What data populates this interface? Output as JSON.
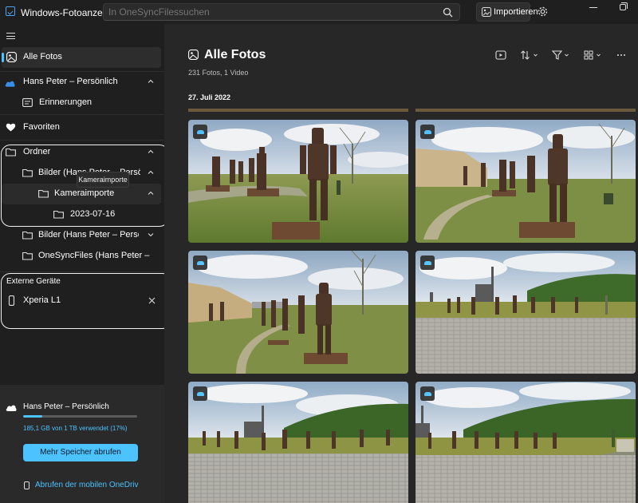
{
  "titlebar": {
    "app_title": "Windows-Fotoanzeige",
    "search_placeholder": "In OneSyncFilessuchen",
    "import_label": "Importieren"
  },
  "sidebar": {
    "all_photos": "Alle Fotos",
    "account": "Hans Peter – Persönlich",
    "memories": "Erinnerungen",
    "favorites": "Favoriten",
    "folders": "Ordner",
    "folder_pictures_1": "Bilder (Hans Peter – Persönlich)",
    "folder_camera_imports": "Kameraimporte",
    "folder_date": "2023-07-16",
    "folder_pictures_2": "Bilder (Hans Peter – Persönlich)",
    "folder_onesync": "OneSyncFiles (Hans Peter – Persönlich)",
    "tooltip": "Kameraimporte",
    "external_devices": "Externe Geräte",
    "device": "Xperia L1",
    "storage": {
      "title": "Hans Peter – Persönlich",
      "used_text": "185,1 GB von 1 TB verwendet (17%)",
      "used_fraction": 0.17,
      "more_storage": "Mehr Speicher abrufen",
      "mobile_link": "Abrufen der mobilen OneDrive-App"
    }
  },
  "main": {
    "title": "Alle Fotos",
    "subtitle": "231 Fotos, 1 Video",
    "date_group": "27. Juli 2022"
  },
  "colors": {
    "accent": "#4cc2ff",
    "background": "#202020",
    "panel": "#272727"
  }
}
